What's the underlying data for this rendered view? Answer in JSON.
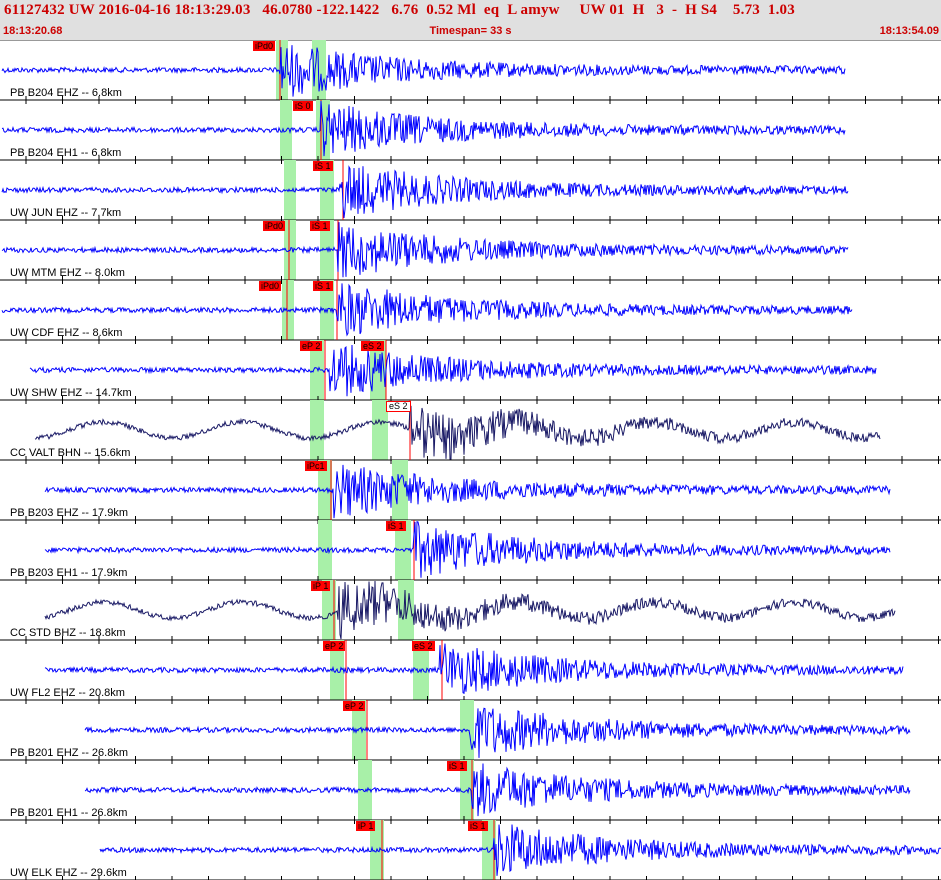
{
  "header": {
    "info_line": "61127432 UW 2016-04-16 18:13:29.03   46.0780 -122.1422   6.76  0.52 Ml  eq  L amyw     UW 01  H   3  -  H S4    5.73  1.03",
    "start_time": "18:13:20.68",
    "timespan": "Timespan=  33 s",
    "end_time": "18:13:54.09"
  },
  "colors": {
    "trace": "#0000ff",
    "trace_dark": "#1a1a66",
    "pick_red": "#ff0000",
    "window_green": "#a8f0a8",
    "header_text": "#cc0000"
  },
  "channels": [
    {
      "label": "PB B204 EHZ -- 6.8km",
      "color": "trace",
      "picks": [
        {
          "text": "iPd0",
          "x_ms": 0
        }
      ]
    },
    {
      "label": "PB B204 EH1 -- 6.8km",
      "color": "trace",
      "picks": [
        {
          "text": "iS 0"
        }
      ]
    },
    {
      "label": "UW JUN EHZ -- 7.7km",
      "color": "trace",
      "picks": [
        {
          "text": "iS 1"
        }
      ]
    },
    {
      "label": "UW MTM EHZ -- 8.0km",
      "color": "trace",
      "picks": [
        {
          "text": "iPd0"
        },
        {
          "text": "iS 1"
        }
      ]
    },
    {
      "label": "UW CDF EHZ -- 8.6km",
      "color": "trace",
      "picks": [
        {
          "text": "iPd0"
        },
        {
          "text": "iS 1"
        }
      ]
    },
    {
      "label": "UW SHW EHZ -- 14.7km",
      "color": "trace",
      "picks": [
        {
          "text": "eP 2"
        },
        {
          "text": "eS 2"
        }
      ]
    },
    {
      "label": "CC VALT BHN -- 15.6km",
      "color": "trace_dark",
      "picks": [
        {
          "text": "eS 2"
        }
      ]
    },
    {
      "label": "PB B203 EHZ -- 17.9km",
      "color": "trace",
      "picks": [
        {
          "text": "iPc1"
        }
      ]
    },
    {
      "label": "PB B203 EH1 -- 17.9km",
      "color": "trace",
      "picks": [
        {
          "text": "iS 1"
        }
      ]
    },
    {
      "label": "CC STD BHZ -- 18.8km",
      "color": "trace_dark",
      "picks": [
        {
          "text": "iP 1"
        }
      ]
    },
    {
      "label": "UW FL2 EHZ -- 20.8km",
      "color": "trace",
      "picks": [
        {
          "text": "eP 2"
        },
        {
          "text": "eS 2"
        }
      ]
    },
    {
      "label": "PB B201 EHZ -- 26.8km",
      "color": "trace",
      "picks": [
        {
          "text": "eP 2"
        }
      ]
    },
    {
      "label": "PB B201 EH1 -- 26.8km",
      "color": "trace",
      "picks": [
        {
          "text": "iS 1"
        }
      ]
    },
    {
      "label": "UW ELK EHZ -- 29.6km",
      "color": "trace",
      "picks": [
        {
          "text": "iP 1"
        },
        {
          "text": "iS 1"
        }
      ]
    }
  ]
}
